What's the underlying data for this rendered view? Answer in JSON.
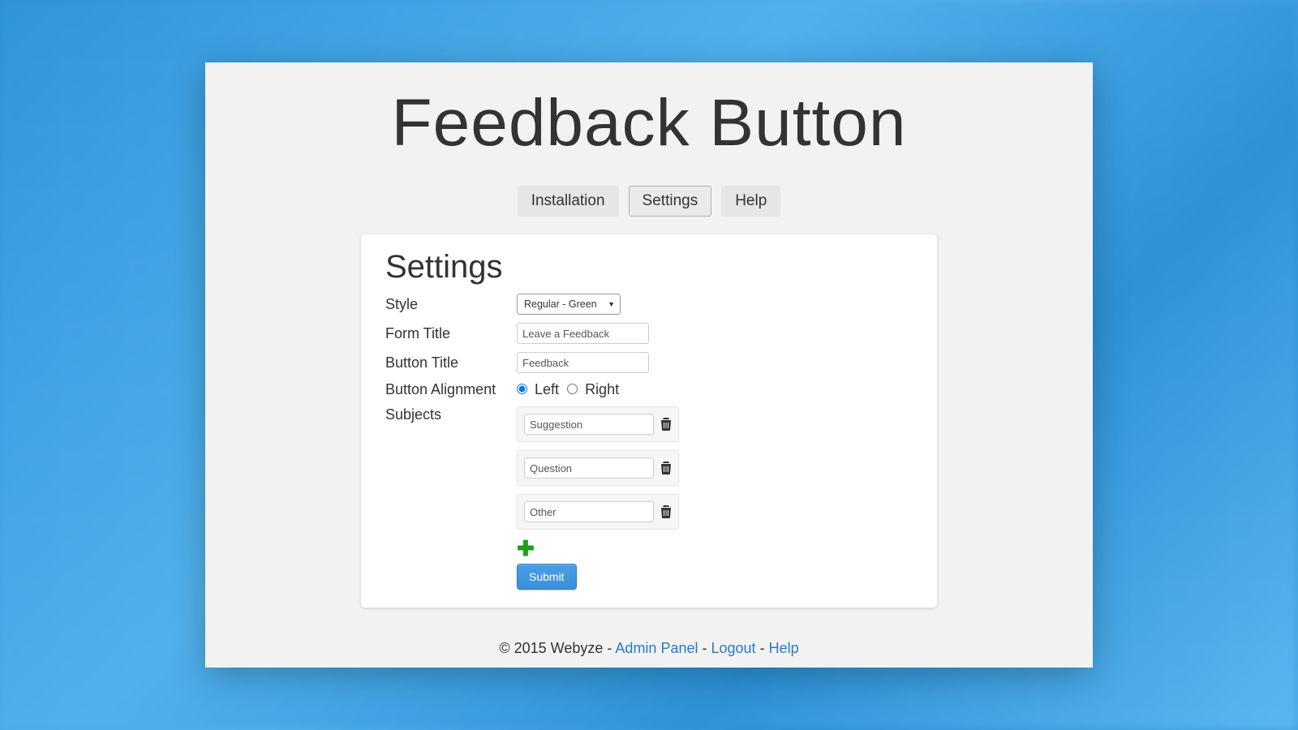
{
  "header": {
    "title": "Feedback Button"
  },
  "tabs": {
    "installation": "Installation",
    "settings": "Settings",
    "help": "Help",
    "active": "settings"
  },
  "section": {
    "title": "Settings"
  },
  "form": {
    "labels": {
      "style": "Style",
      "form_title": "Form Title",
      "button_title": "Button Title",
      "button_alignment": "Button Alignment",
      "subjects": "Subjects"
    },
    "style_value": "Regular - Green",
    "form_title_value": "Leave a Feedback",
    "button_title_value": "Feedback",
    "alignment": {
      "left_label": "Left",
      "right_label": "Right",
      "selected": "left"
    },
    "subjects": [
      "Suggestion",
      "Question",
      "Other"
    ],
    "submit_label": "Submit"
  },
  "footer": {
    "copyright": "© 2015 Webyze",
    "links": {
      "admin_panel": "Admin Panel",
      "logout": "Logout",
      "help": "Help"
    }
  }
}
